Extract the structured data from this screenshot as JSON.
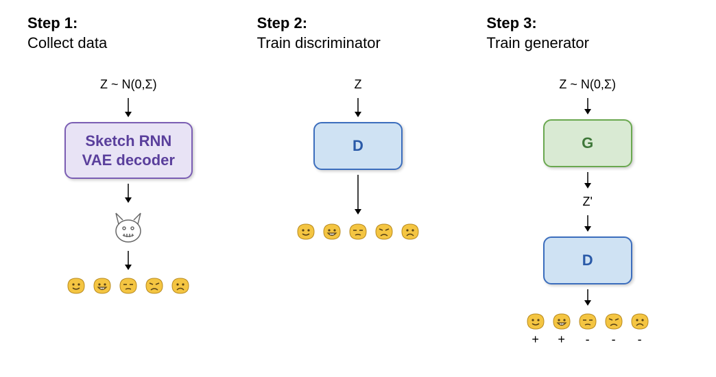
{
  "steps": [
    {
      "title": "Step 1:",
      "subtitle": "Collect data",
      "input": "Z ~ N(0,Σ)",
      "box": "Sketch RNN\nVAE decoder"
    },
    {
      "title": "Step 2:",
      "subtitle": "Train discriminator",
      "input": "Z",
      "box": "D"
    },
    {
      "title": "Step 3:",
      "subtitle": "Train generator",
      "input": "Z ~ N(0,Σ)",
      "box_g": "G",
      "mid": "Z'",
      "box_d": "D",
      "symbols": [
        "+",
        "+",
        "-",
        "-",
        "-"
      ]
    }
  ],
  "faces": [
    "happy",
    "grin",
    "neutral",
    "frown",
    "sad"
  ],
  "colors": {
    "face_fill": "#f4c542",
    "face_stroke": "#b88a1f",
    "purple": "#5a3f9c",
    "blue": "#2a5aa8",
    "green": "#3f783a"
  }
}
